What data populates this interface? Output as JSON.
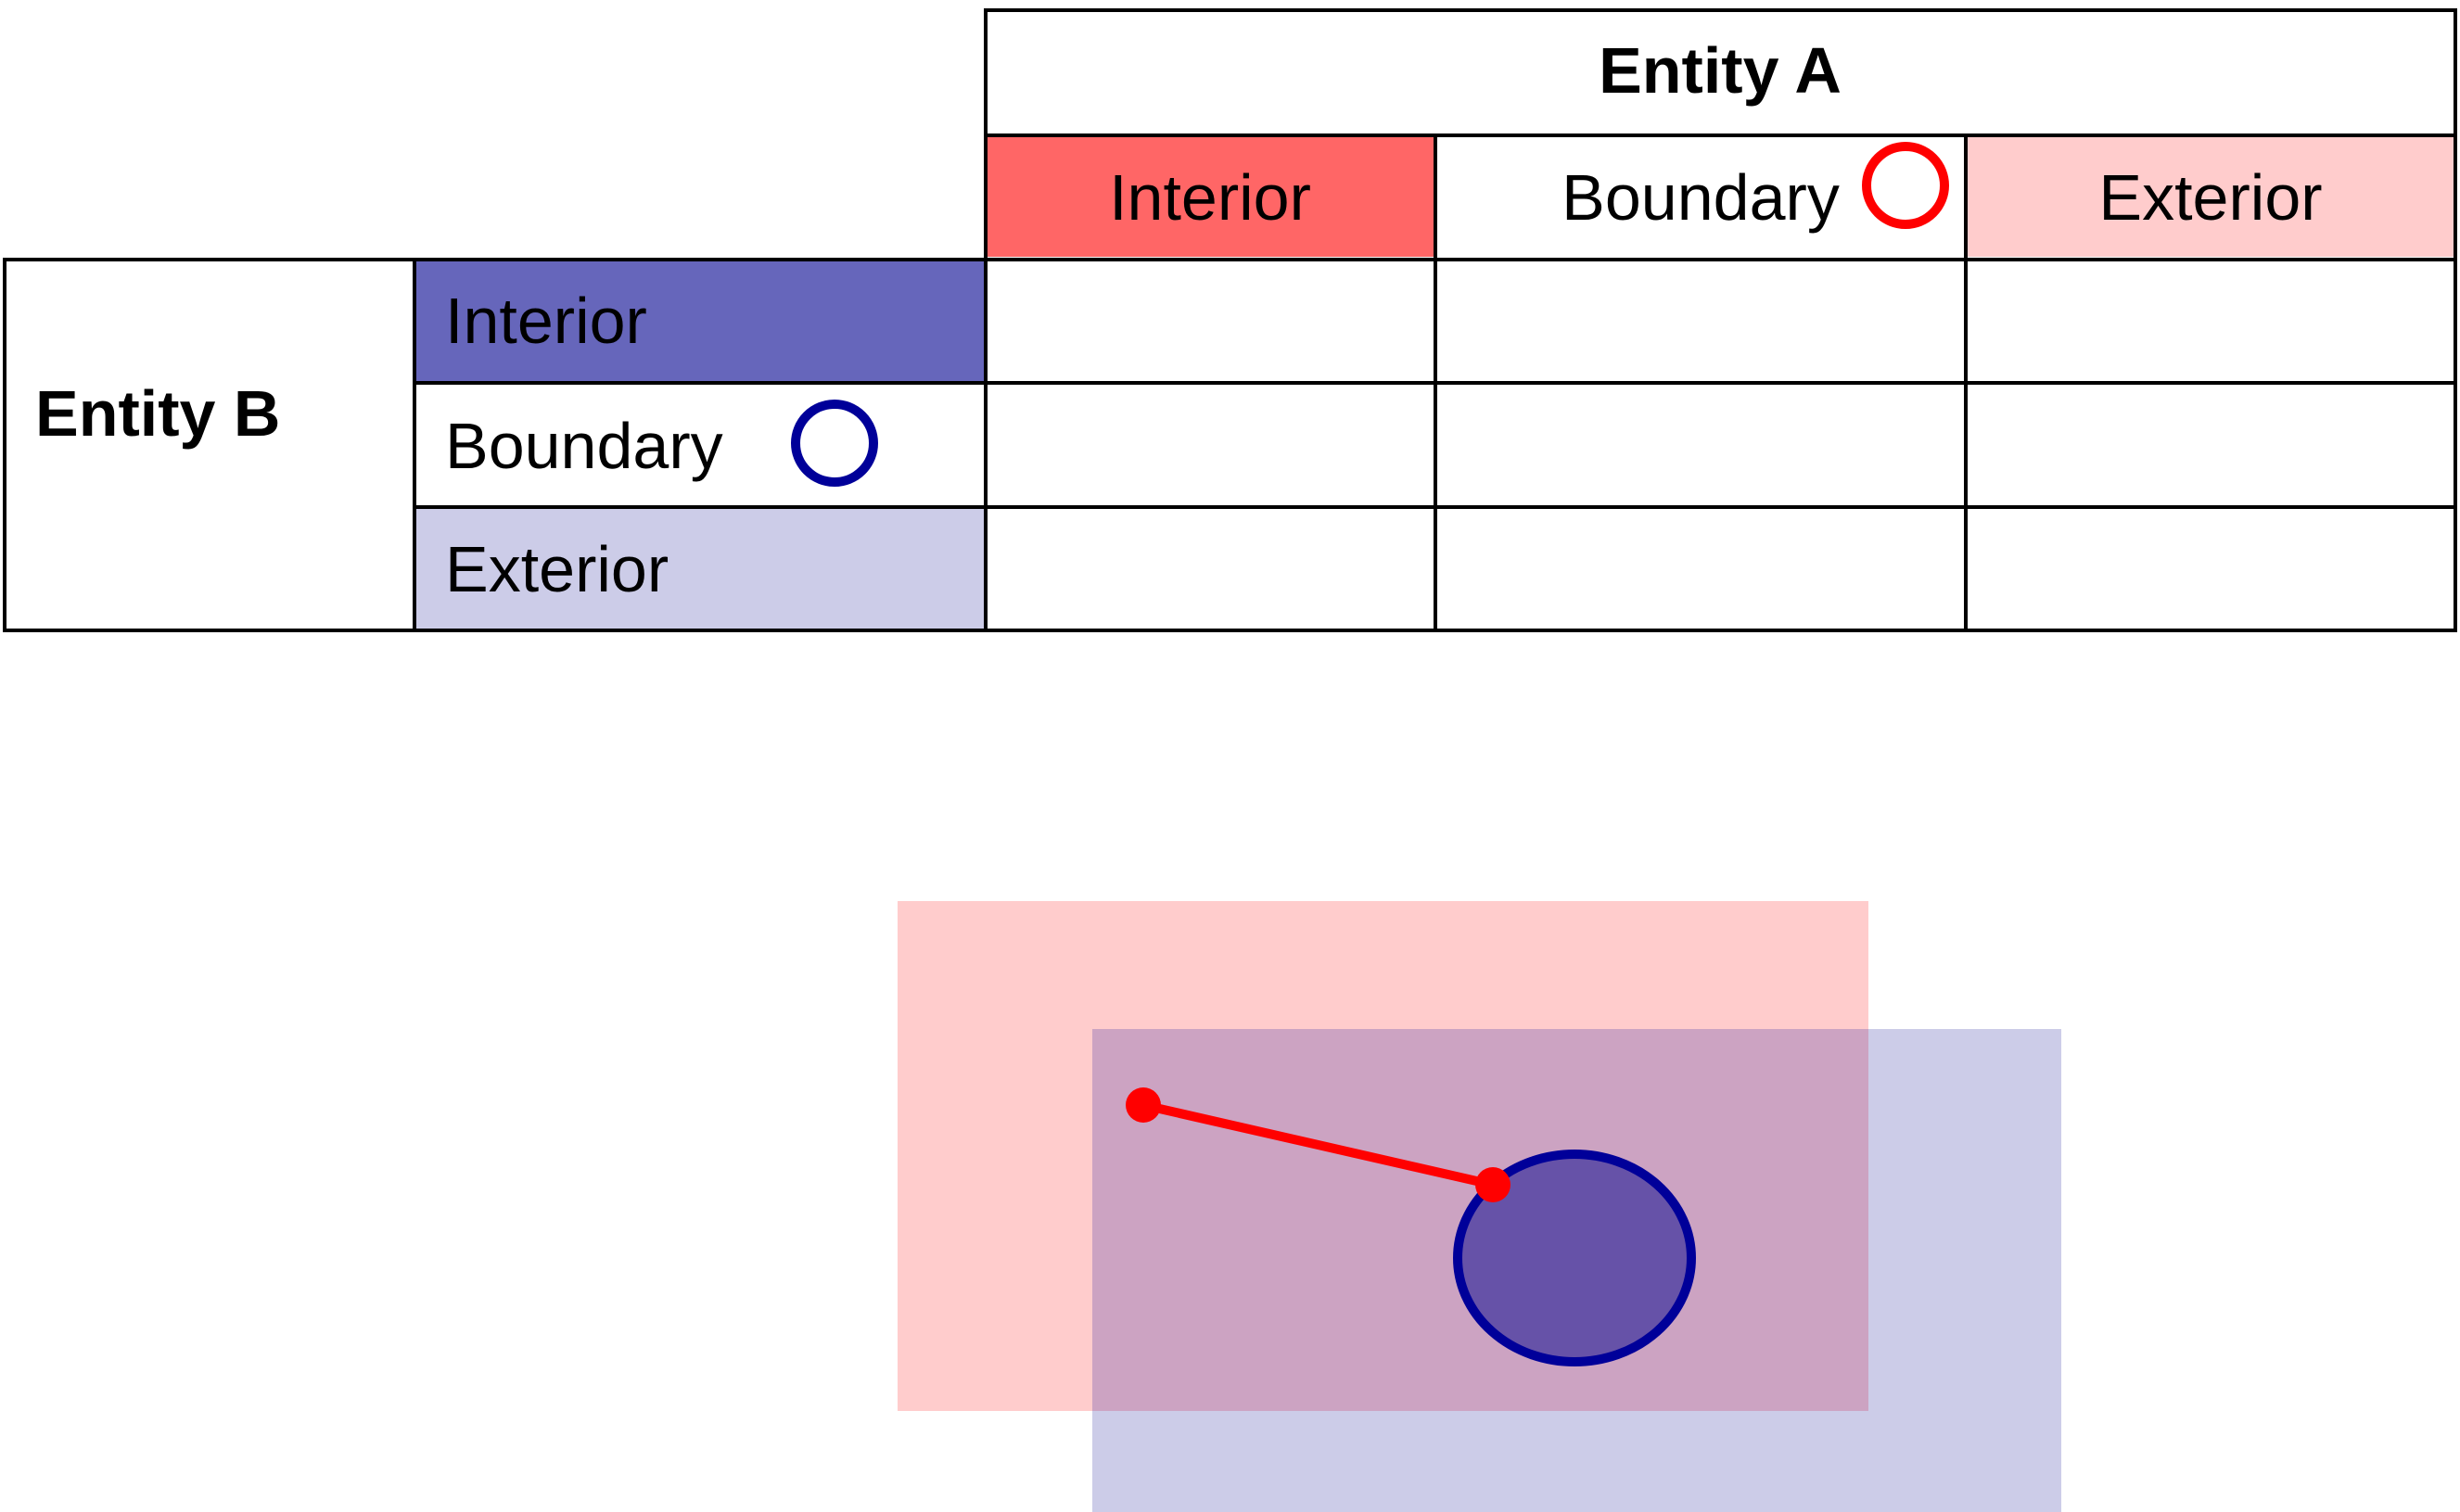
{
  "matrix": {
    "col_group_label": "Entity A",
    "row_group_label": "Entity B",
    "columns": [
      {
        "label": "Interior",
        "fill": "#FF6666"
      },
      {
        "label": "Boundary",
        "fill": "#FFFFFF",
        "marker": "ring",
        "marker_color": "#FF0000"
      },
      {
        "label": "Exterior",
        "fill": "#FFCCCC"
      }
    ],
    "rows": [
      {
        "label": "Interior",
        "fill": "#6666BB"
      },
      {
        "label": "Boundary",
        "fill": "#FFFFFF",
        "marker": "ring",
        "marker_color": "#000099"
      },
      {
        "label": "Exterior",
        "fill": "#CCCCE8"
      }
    ],
    "cells": [
      [
        "",
        "",
        ""
      ],
      [
        "",
        "",
        ""
      ],
      [
        "",
        "",
        ""
      ]
    ]
  },
  "illustration": {
    "entity_a_extent_color": "#FFCCCC",
    "entity_b_extent_color": "#CCCCE8",
    "overlap_color": "#CCA3C2",
    "entity_a_line_color": "#FF0000",
    "entity_b_polygon_fill": "#6652A8",
    "entity_b_polygon_stroke": "#000099"
  }
}
